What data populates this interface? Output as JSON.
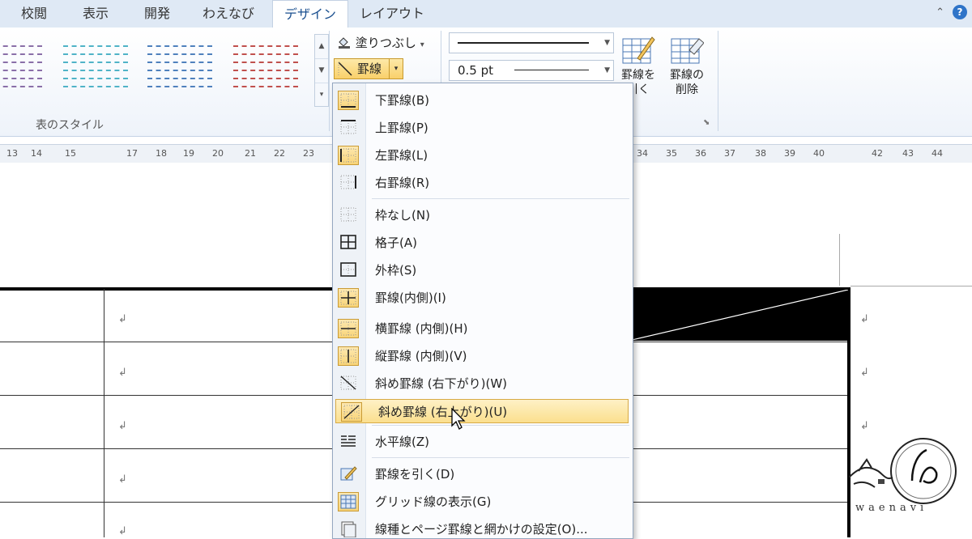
{
  "tabs": [
    {
      "label": "校閲",
      "active": false
    },
    {
      "label": "表示",
      "active": false
    },
    {
      "label": "開発",
      "active": false
    },
    {
      "label": "わえなび",
      "active": false
    },
    {
      "label": "デザイン",
      "active": true
    },
    {
      "label": "レイアウト",
      "active": false
    }
  ],
  "ribbon": {
    "table_styles_label": "表のスタイル",
    "shading_label": "塗りつぶし",
    "borders_label": "罫線",
    "pen_weight": "0.5 pt",
    "draw_table_label": [
      "罫線を",
      "引く"
    ],
    "erase_label": [
      "罫線の",
      "削除"
    ],
    "style_colors": [
      "#8a6fa8",
      "#4fb3c7",
      "#4f81bd",
      "#c0504d"
    ]
  },
  "ruler": {
    "left_ticks": [
      "13",
      "14",
      "15",
      "17",
      "18",
      "19",
      "20",
      "21",
      "22",
      "23"
    ],
    "right_ticks": [
      "34",
      "35",
      "36",
      "37",
      "38",
      "39",
      "40",
      "42",
      "43",
      "44"
    ]
  },
  "border_menu": {
    "items": [
      {
        "icon": "bottom-border-icon",
        "label": "下罫線(B)",
        "selected": true
      },
      {
        "icon": "top-border-icon",
        "label": "上罫線(P)",
        "selected": false
      },
      {
        "icon": "left-border-icon",
        "label": "左罫線(L)",
        "selected": true
      },
      {
        "icon": "right-border-icon",
        "label": "右罫線(R)",
        "selected": false
      },
      {
        "icon": "no-border-icon",
        "label": "枠なし(N)",
        "selected": false
      },
      {
        "icon": "all-borders-icon",
        "label": "格子(A)",
        "selected": false
      },
      {
        "icon": "outside-borders-icon",
        "label": "外枠(S)",
        "selected": false
      },
      {
        "icon": "inside-borders-icon",
        "label": "罫線(内側)(I)",
        "selected": true
      },
      {
        "icon": "inside-horizontal-border-icon",
        "label": "横罫線 (内側)(H)",
        "selected": true
      },
      {
        "icon": "inside-vertical-border-icon",
        "label": "縦罫線 (内側)(V)",
        "selected": true
      },
      {
        "icon": "diagonal-down-border-icon",
        "label": "斜め罫線 (右下がり)(W)",
        "selected": false
      },
      {
        "icon": "diagonal-up-border-icon",
        "label": "斜め罫線 (右上がり)(U)",
        "selected": true,
        "highlighted": true
      },
      {
        "icon": "horizontal-line-icon",
        "label": "水平線(Z)",
        "selected": false
      },
      {
        "icon": "draw-table-icon",
        "label": "罫線を引く(D)",
        "selected": false
      },
      {
        "icon": "view-gridlines-icon",
        "label": "グリッド線の表示(G)",
        "selected": true
      },
      {
        "icon": "borders-shading-icon",
        "label": "線種とページ罫線と網かけの設定(O)...",
        "selected": false
      }
    ]
  },
  "document": {
    "paragraph_mark": "↲"
  },
  "logo": {
    "text": "waenavi"
  }
}
